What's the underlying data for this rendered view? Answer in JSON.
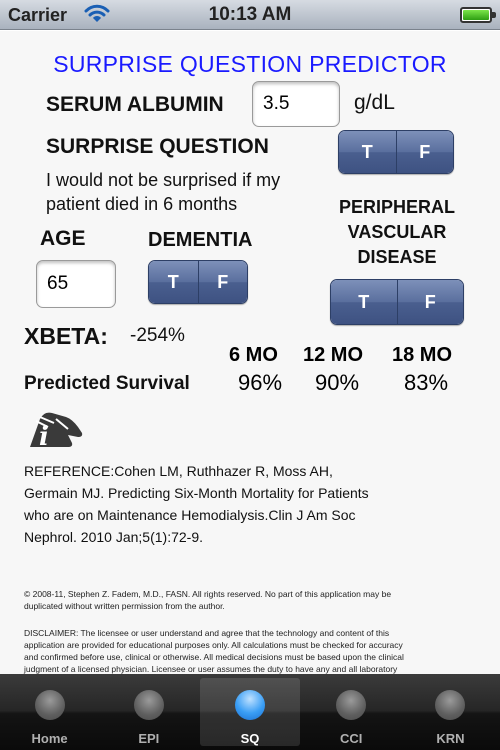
{
  "status_bar": {
    "carrier": "Carrier",
    "time": "10:13 AM"
  },
  "title": "SURPRISE QUESTION PREDICTOR",
  "serum_albumin": {
    "label": "SERUM ALBUMIN",
    "value": "3.5",
    "unit": "g/dL"
  },
  "surprise_question": {
    "label": "SURPRISE QUESTION",
    "text_line1": "I would not be surprised if my",
    "text_line2": "patient died in 6 months",
    "true_label": "T",
    "false_label": "F"
  },
  "age": {
    "label": "AGE",
    "value": "65"
  },
  "dementia": {
    "label": "DEMENTIA",
    "true_label": "T",
    "false_label": "F"
  },
  "pvd": {
    "label_line1": "PERIPHERAL",
    "label_line2": "VASCULAR",
    "label_line3": "DISEASE",
    "true_label": "T",
    "false_label": "F"
  },
  "xbeta": {
    "label": "XBETA:",
    "value": "-254%"
  },
  "survival": {
    "label": "Predicted Survival",
    "headers": [
      "6 MO",
      "12 MO",
      "18 MO"
    ],
    "values": [
      "96%",
      "90%",
      "83%"
    ]
  },
  "reference": {
    "line1": "REFERENCE:Cohen LM, Ruthhazer R, Moss AH,",
    "line2": "Germain MJ. Predicting Six-Month Mortality for Patients",
    "line3": "who are on Maintenance Hemodialysis.Clin J Am Soc",
    "line4": "Nephrol. 2010 Jan;5(1):72-9."
  },
  "copyright": {
    "line1": "© 2008-11, Stephen Z. Fadem, M.D., FASN. All rights reserved. No part of this application may be",
    "line2": "duplicated without written permission from the author."
  },
  "disclaimer": {
    "line1": "DISCLAIMER: The licensee or user understand and agree that the technology and content of this",
    "line2": "application are provided for educational purposes only. All calculations must be checked for accuracy",
    "line3": "and confirmed before use, clinical or otherwise. All medical decisions must be based upon the clinical",
    "line4": "judgment of a licensed physician. Licensee or user assumes the duty to have any and all laboratory"
  },
  "tabs": [
    {
      "label": "Home",
      "active": false
    },
    {
      "label": "EPI",
      "active": false
    },
    {
      "label": "SQ",
      "active": true
    },
    {
      "label": "CCI",
      "active": false
    },
    {
      "label": "KRN",
      "active": false
    }
  ],
  "colors": {
    "title": "#1a1aff",
    "segment": "#5a6f9e",
    "active_tab_icon": "#3a9ef5",
    "battery": "#4ccf2a"
  },
  "icons": {
    "wifi": "wifi-icon",
    "battery": "battery-icon",
    "info": "info-hand-icon",
    "tab": "tab-circle-icon"
  }
}
